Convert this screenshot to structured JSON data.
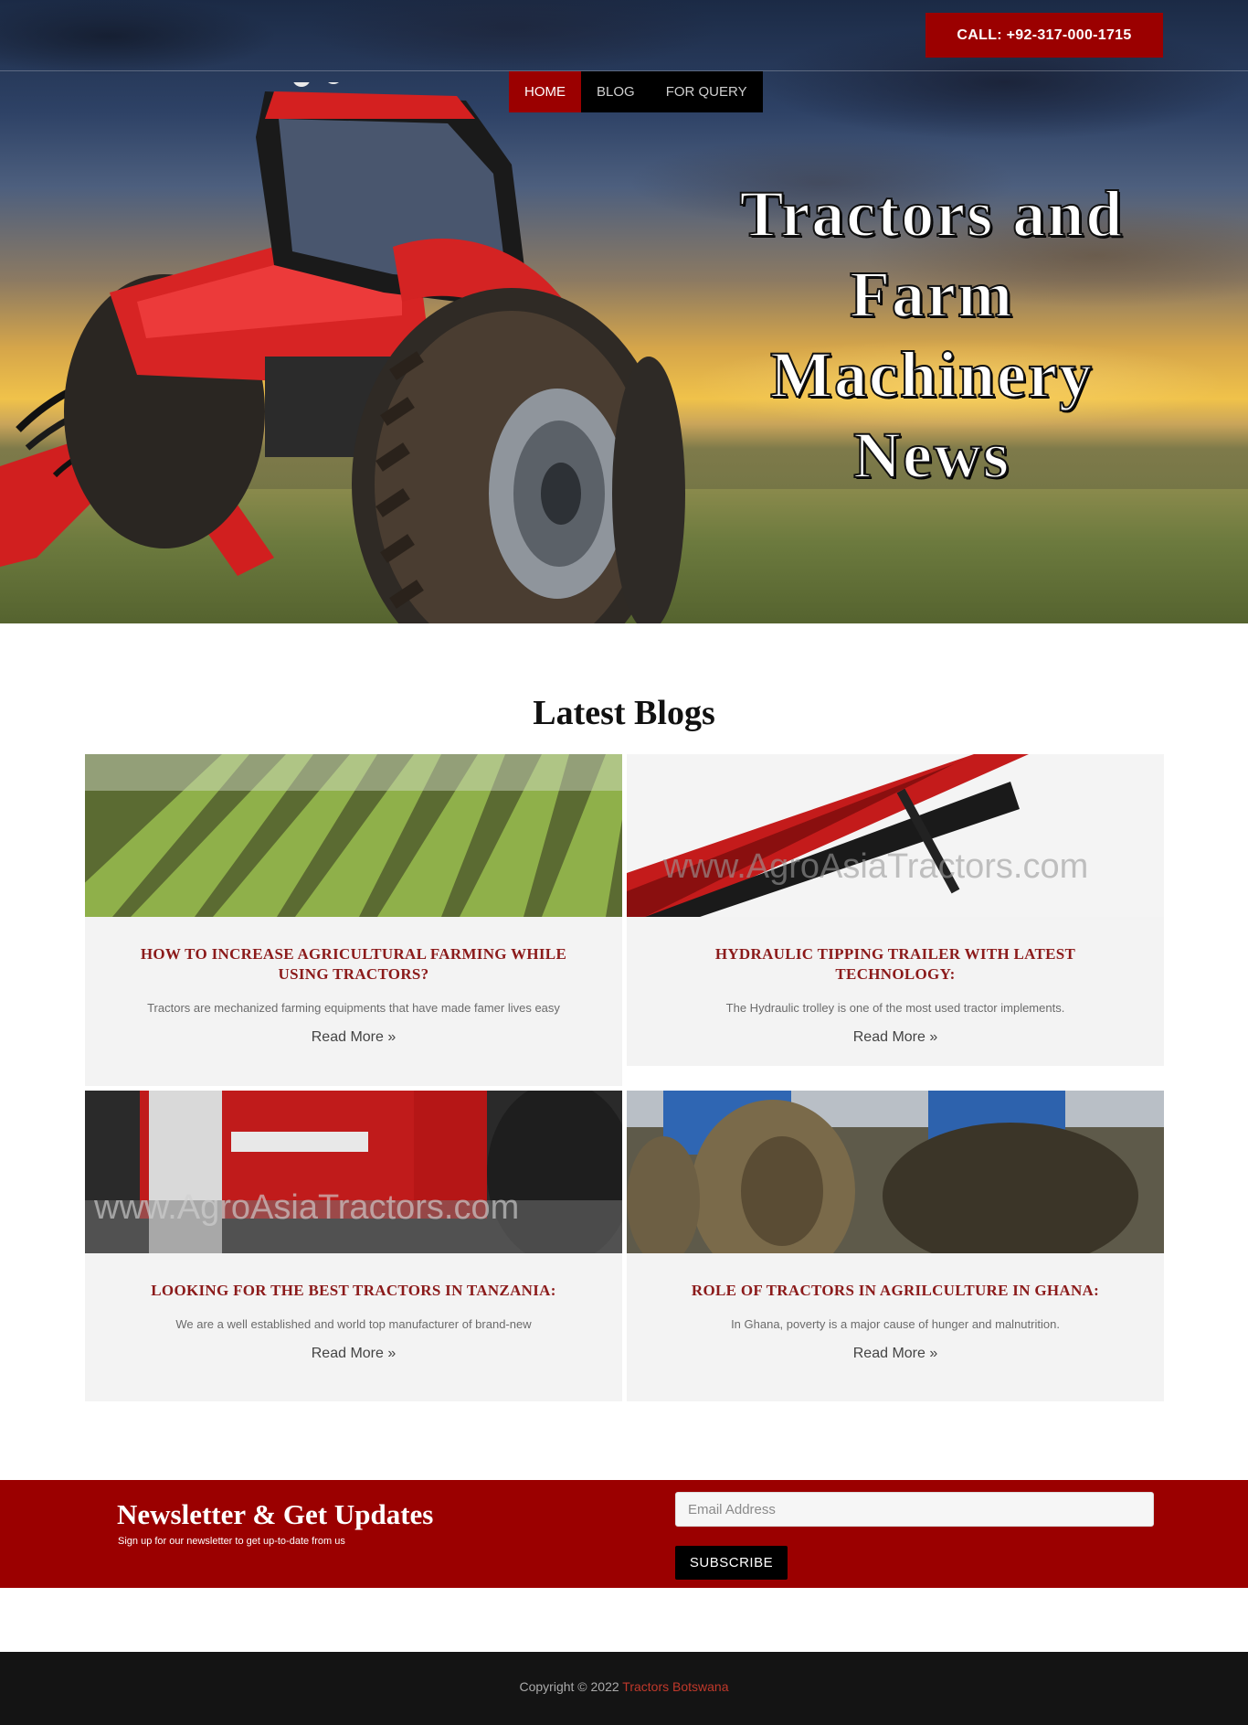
{
  "header": {
    "call_label": "CALL: +92-317-000-1715",
    "nav": [
      {
        "label": "HOME",
        "active": true
      },
      {
        "label": "BLOG",
        "active": false
      },
      {
        "label": "FOR QUERY",
        "active": false
      }
    ],
    "hero_title": "Tractors and Farm Machinery News"
  },
  "blogs": {
    "section_title": "Latest Blogs",
    "posts": [
      {
        "title": "HOW TO INCREASE AGRICULTURAL FARMING WHILE USING TRACTORS?",
        "excerpt": "Tractors are mechanized farming equipments that have made famer lives easy",
        "read_more": "Read More »",
        "image": "crop-rows-image"
      },
      {
        "title": "HYDRAULIC TIPPING TRAILER WITH LATEST TECHNOLOGY:",
        "excerpt": "The Hydraulic trolley is one of the most used tractor implements.",
        "read_more": "Read More »",
        "image": "red-trailer-image"
      },
      {
        "title": "LOOKING FOR THE BEST TRACTORS IN TANZANIA:",
        "excerpt": "We are a well established and world top manufacturer of brand-new",
        "read_more": "Read More »",
        "image": "red-tractor-image"
      },
      {
        "title": "ROLE OF TRACTORS IN AGRILCULTURE IN GHANA:",
        "excerpt": "In Ghana, poverty is a major cause of hunger and malnutrition.",
        "read_more": "Read More »",
        "image": "muddy-tires-image"
      }
    ],
    "watermark": "www.AgroAsiaTractors.com"
  },
  "newsletter": {
    "title": "Newsletter & Get Updates",
    "subtitle": "Sign up for our newsletter to get up-to-date from us",
    "email_placeholder": "Email Address",
    "subscribe_label": "SUBSCRIBE"
  },
  "footer": {
    "copyright": "Copyright © 2022",
    "brand": "Tractors Botswana"
  },
  "colors": {
    "accent": "#9b0000",
    "title_red": "#8b1a1a",
    "footer_bg": "#141414"
  }
}
